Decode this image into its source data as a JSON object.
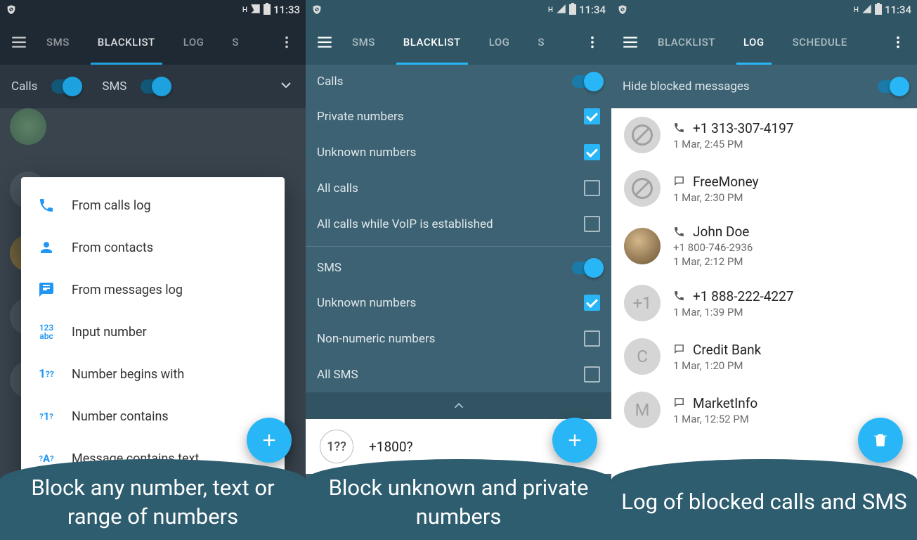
{
  "status": {
    "operator_tag": "H",
    "time1": "11:33",
    "time2": "11:34",
    "time3": "11:34"
  },
  "tabs": {
    "sms": "SMS",
    "blacklist": "BLACKLIST",
    "log": "LOG",
    "schedule": "SCHEDULE",
    "s_cut": "S"
  },
  "phone1": {
    "subbar": {
      "calls": "Calls",
      "sms": "SMS"
    },
    "popup": [
      "From calls log",
      "From contacts",
      "From messages log",
      "Input number",
      "Number begins with",
      "Number contains",
      "Message contains text"
    ],
    "caption": "Block any number, text or range of numbers"
  },
  "phone2": {
    "calls_header": "Calls",
    "calls_items": [
      {
        "label": "Private numbers",
        "checked": true
      },
      {
        "label": "Unknown numbers",
        "checked": true
      },
      {
        "label": "All calls",
        "checked": false
      },
      {
        "label": "All calls while VoIP is established",
        "checked": false
      }
    ],
    "sms_header": "SMS",
    "sms_items": [
      {
        "label": "Unknown numbers",
        "checked": true
      },
      {
        "label": "Non-numeric numbers",
        "checked": false
      },
      {
        "label": "All SMS",
        "checked": false
      }
    ],
    "pattern_badge": "1??",
    "pattern_text": "+1800?",
    "caption": "Block unknown and private numbers"
  },
  "phone3": {
    "hide_label": "Hide blocked messages",
    "log": [
      {
        "type": "call",
        "title": "+1 313-307-4197",
        "sub": "",
        "time": "1 Mar, 2:45 PM",
        "avatar": "block"
      },
      {
        "type": "sms",
        "title": "FreeMoney",
        "sub": "",
        "time": "1 Mar, 2:30 PM",
        "avatar": "block"
      },
      {
        "type": "call",
        "title": "John Doe",
        "sub": "+1 800-746-2936",
        "time": "1 Mar, 2:12 PM",
        "avatar": "photo"
      },
      {
        "type": "call",
        "title": "+1 888-222-4227",
        "sub": "",
        "time": "1 Mar, 1:39 PM",
        "avatar": "plus"
      },
      {
        "type": "sms",
        "title": "Credit Bank",
        "sub": "",
        "time": "1 Mar, 1:20 PM",
        "avatar": "letter-C"
      },
      {
        "type": "sms",
        "title": "MarketInfo",
        "sub": "",
        "time": "1 Mar, 12:52 PM",
        "avatar": "letter-M"
      }
    ],
    "caption": "Log of blocked calls and SMS"
  }
}
